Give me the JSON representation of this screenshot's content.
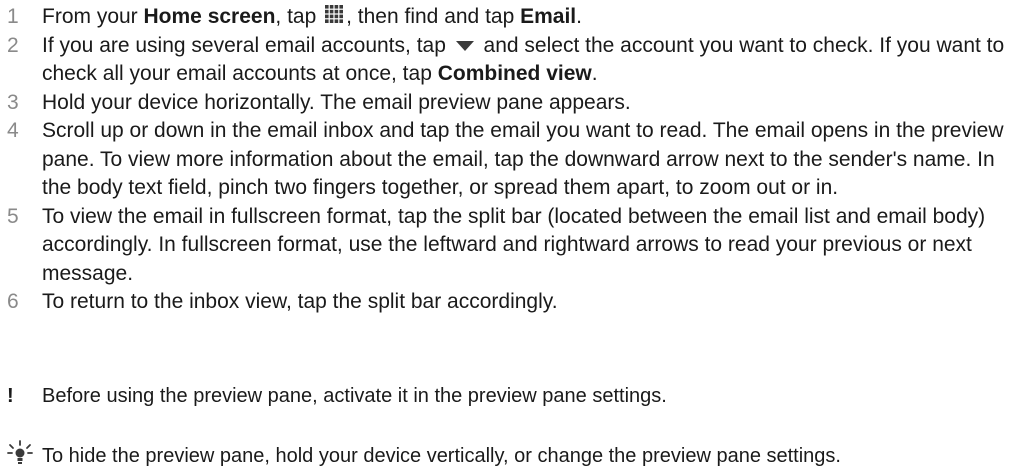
{
  "steps": [
    {
      "num": "1",
      "p1": "From your ",
      "b1": "Home screen",
      "p2": ", tap ",
      "icon": "apps-grid-icon",
      "p3": ", then find and tap ",
      "b2": "Email",
      "p4": "."
    },
    {
      "num": "2",
      "p1": "If you are using several email accounts, tap ",
      "icon": "dropdown-triangle-icon",
      "p2": " and select the account you want to check. If you want to check all your email accounts at once, tap ",
      "b1": "Combined view",
      "p3": "."
    },
    {
      "num": "3",
      "text": "Hold your device horizontally. The email preview pane appears."
    },
    {
      "num": "4",
      "text": "Scroll up or down in the email inbox and tap the email you want to read. The email opens in the preview pane. To view more information about the email, tap the downward arrow next to the sender's name. In the body text field, pinch two fingers together, or spread them apart, to zoom out or in."
    },
    {
      "num": "5",
      "text": "To view the email in fullscreen format, tap the split bar (located between the email list and email body) accordingly. In fullscreen format, use the leftward and rightward arrows to read your previous or next message."
    },
    {
      "num": "6",
      "text": "To return to the inbox view, tap the split bar accordingly."
    }
  ],
  "warning": {
    "icon": "exclamation-icon",
    "symbol": "!",
    "text": "Before using the preview pane, activate it in the preview pane settings."
  },
  "tip": {
    "icon": "lightbulb-icon",
    "text": "To hide the preview pane, hold your device vertically, or change the preview pane settings."
  }
}
